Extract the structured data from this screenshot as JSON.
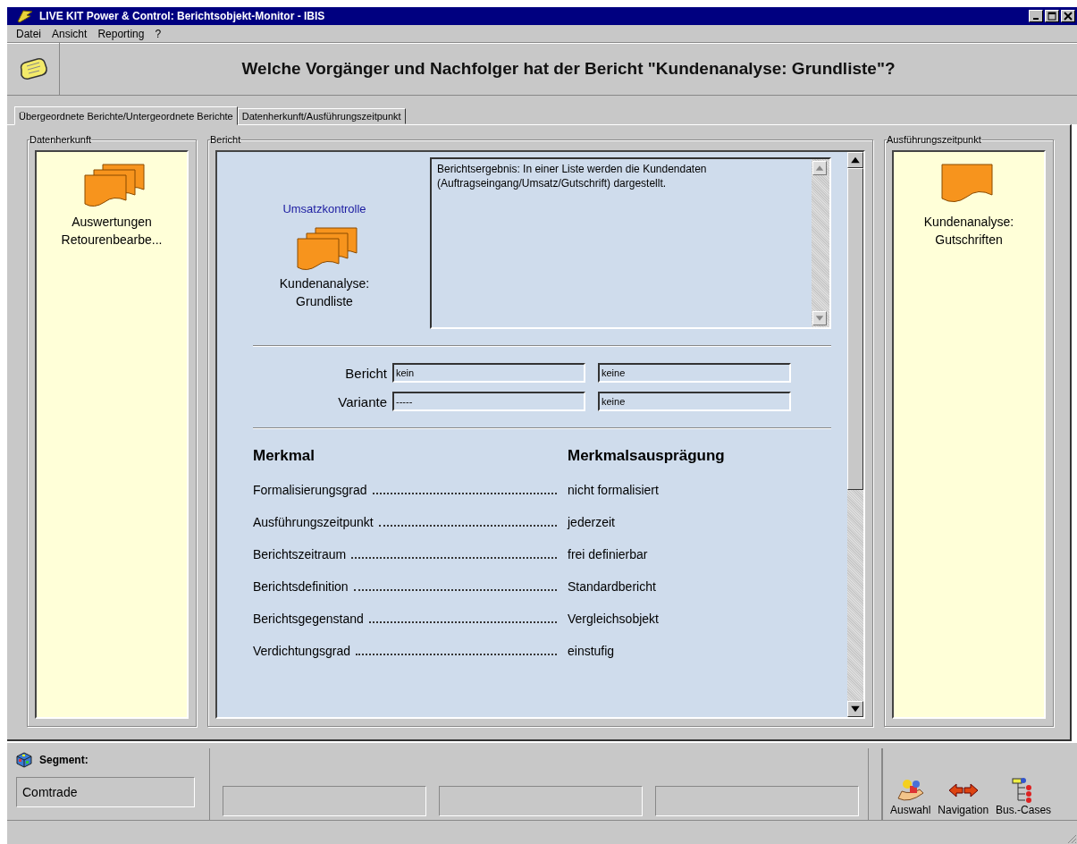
{
  "window": {
    "title": "LIVE KIT Power & Control: Berichtsobjekt-Monitor - IBIS"
  },
  "menu": [
    "Datei",
    "Ansicht",
    "Reporting",
    "?"
  ],
  "header": {
    "question": "Welche Vorgänger und Nachfolger hat der Bericht \"Kundenanalyse: Grundliste\"?"
  },
  "tabs": [
    {
      "label": "Übergeordnete Berichte/Untergeordnete Berichte",
      "selected": true
    },
    {
      "label": "Datenherkunft/Ausführungszeitpunkt",
      "selected": false
    }
  ],
  "left_group": {
    "title": "Datenherkunft",
    "items": [
      {
        "kind": "stack",
        "lines": [
          "Auswertungen",
          "Retourenbearbe..."
        ]
      }
    ]
  },
  "center": {
    "title": "Bericht",
    "parent_link": "Umsatzkontrolle",
    "report": {
      "kind": "stack",
      "lines": [
        "Kundenanalyse:",
        "Grundliste"
      ]
    },
    "description": "Berichtsergebnis: In einer Liste werden die Kundendaten (Auftragseingang/Umsatz/Gutschrift) dargestellt.",
    "fields": [
      {
        "label": "Bericht",
        "value1": "kein",
        "value2": "keine"
      },
      {
        "label": "Variante",
        "value1": "-----",
        "value2": "keine"
      }
    ],
    "table": {
      "columns": [
        "Merkmal",
        "Merkmalsausprägung"
      ],
      "rows": [
        {
          "feature": "Formalisierungsgrad",
          "value": "nicht formalisiert"
        },
        {
          "feature": "Ausführungszeitpunkt",
          "value": "jederzeit"
        },
        {
          "feature": "Berichtszeitraum",
          "value": "frei definierbar"
        },
        {
          "feature": "Berichtsdefinition",
          "value": "Standardbericht"
        },
        {
          "feature": "Berichtsgegenstand",
          "value": "Vergleichsobjekt"
        },
        {
          "feature": "Verdichtungsgrad",
          "value": "einstufig"
        }
      ]
    }
  },
  "right_group": {
    "title": "Ausführungszeitpunkt",
    "items": [
      {
        "kind": "single",
        "lines": [
          "Kundenanalyse:",
          "Gutschriften"
        ]
      }
    ]
  },
  "bottom": {
    "segment_label": "Segment:",
    "segment_value": "Comtrade",
    "buttons": [
      {
        "kind": "selection",
        "label": "Auswahl"
      },
      {
        "kind": "navigation",
        "label": "Navigation"
      },
      {
        "kind": "cases",
        "label": "Bus.-Cases"
      }
    ]
  }
}
